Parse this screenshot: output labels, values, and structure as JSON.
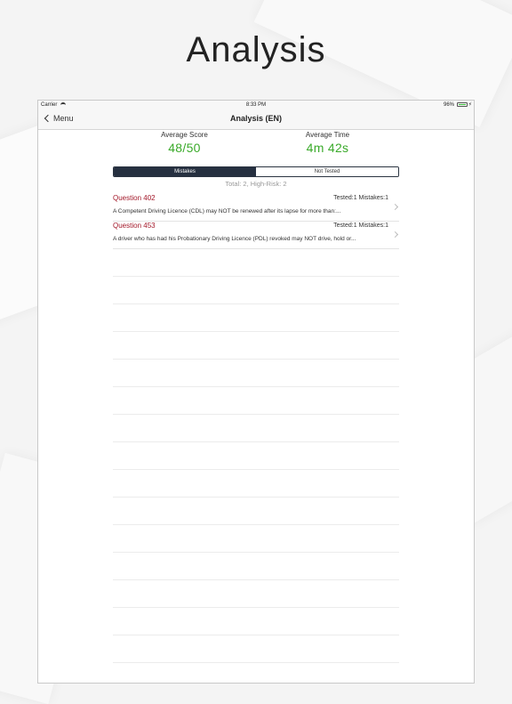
{
  "promo": {
    "title": "Analysis"
  },
  "status_bar": {
    "carrier": "Carrier",
    "time": "8:33 PM",
    "battery": "96%"
  },
  "nav": {
    "back_label": "Menu",
    "title": "Analysis (EN)"
  },
  "stats": {
    "average_score_label": "Average Score",
    "average_score_value": "48/50",
    "average_time_label": "Average Time",
    "average_time_value": "4m 42s"
  },
  "tabs": [
    {
      "label": "Mistakes",
      "active": true
    },
    {
      "label": "Not Tested",
      "active": false
    }
  ],
  "summary": "Total: 2, High-Risk: 2",
  "questions": [
    {
      "title": "Question 402",
      "meta": "Tested:1 Mistakes:1",
      "text": "A Competent Driving Licence (CDL) may NOT be renewed after its lapse for more than:..."
    },
    {
      "title": "Question 453",
      "meta": "Tested:1 Mistakes:1",
      "text": "A driver who has had his Probationary Driving Licence (PDL) revoked may NOT drive, hold or..."
    }
  ],
  "colors": {
    "score_green": "#3aaa2a",
    "question_red": "#a3192a",
    "segment_dark": "#263040"
  }
}
